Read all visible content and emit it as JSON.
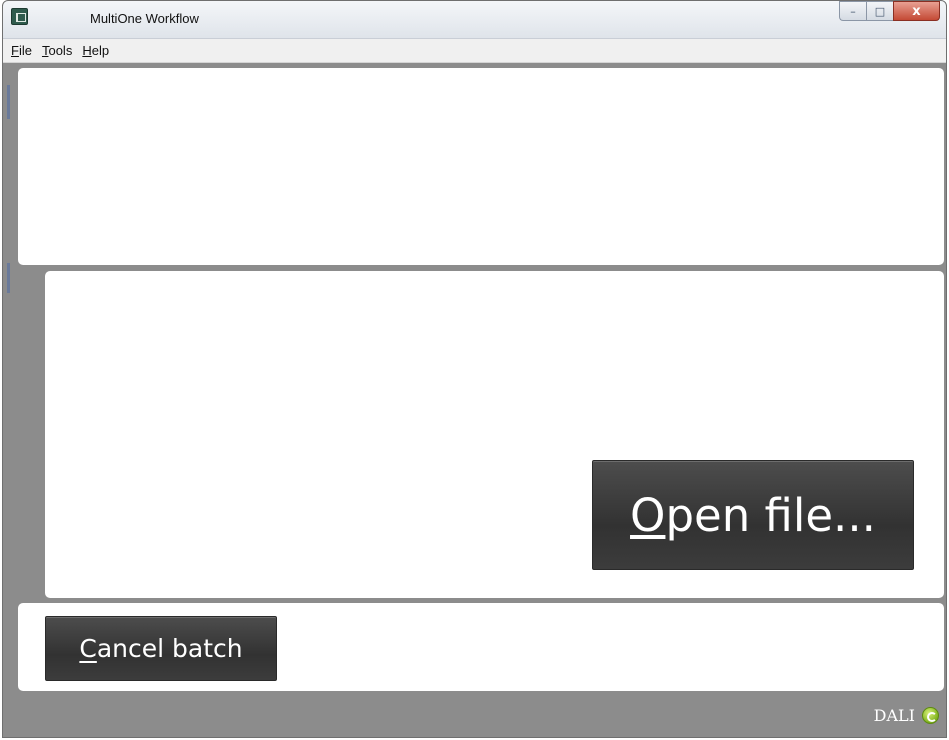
{
  "window": {
    "title": "MultiOne Workflow",
    "controls": {
      "minimize": "–",
      "maximize": "□",
      "close": "x"
    }
  },
  "menu": {
    "items": [
      {
        "accel": "F",
        "rest": "ile"
      },
      {
        "accel": "T",
        "rest": "ools"
      },
      {
        "accel": "H",
        "rest": "elp"
      }
    ]
  },
  "buttons": {
    "open_file": {
      "accel": "O",
      "rest": "pen file..."
    },
    "cancel_batch": {
      "accel": "C",
      "rest": "ancel batch"
    }
  },
  "status": {
    "protocol": "DALI",
    "icon": "dali-connection-icon",
    "icon_color": "#7fb21d"
  }
}
